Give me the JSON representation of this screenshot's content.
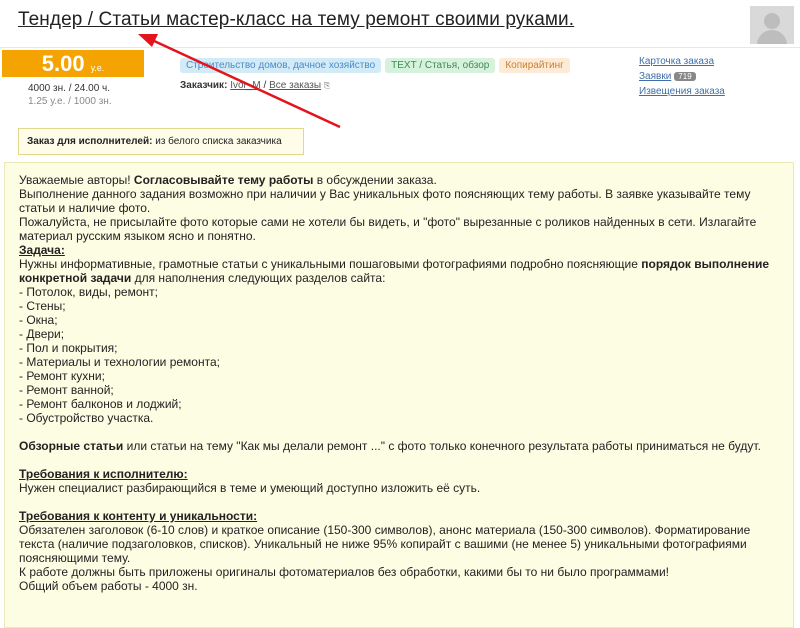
{
  "page": {
    "title": "Тендер / Статьи мастер-класс на тему ремонт своими руками."
  },
  "order": {
    "price": "5.00",
    "currency": "у.е.",
    "volume": "4000 зн. / 24.00 ч.",
    "rate": "1.25 у.е. / 1000 зн.",
    "tags": [
      {
        "label": "Строительство домов, дачное хозяйство",
        "color": "#d3ebf7"
      },
      {
        "label": "TEXT / Статья, обзор",
        "color": "#d6f2dc"
      },
      {
        "label": "Копирайтинг",
        "color": "#fdebd7"
      }
    ],
    "customer_label": "Заказчик:",
    "customer_name": "Ivor_M",
    "customer_sep": "/",
    "all_orders": "Все заказы",
    "links": {
      "card": "Карточка заказа",
      "applications": "Заявки",
      "applications_count": "719",
      "notices": "Извещения заказа"
    },
    "executor_label": "Заказ для исполнителей:",
    "executor_value": "из белого списка заказчика"
  },
  "colors": {
    "price_bg": "#f5a300",
    "arrow": "#e3141b",
    "content_bg": "#fdfde3"
  },
  "content": {
    "intro_1a": "Уважаемые авторы! ",
    "intro_1b": "Согласовывайте тему работы",
    "intro_1c": " в обсуждении заказа.",
    "intro_2": "Выполнение данного задания возможно при наличии у Вас уникальных фото поясняющих тему работы. В заявке указывайте тему статьи и наличие фото.",
    "intro_3": "Пожалуйста, не присылайте фото которые сами не хотели бы видеть, и \"фото\" вырезанные с роликов найденных в сети. Излагайте материал русским языком ясно и понятно.",
    "task_heading": "Задача:",
    "task_a": "Нужны информативные, грамотные статьи с уникальными пошаговыми фотографиями подробно поясняющие ",
    "task_b": "порядок выполнение конкретной задачи",
    "task_c": " для наполнения следующих разделов сайта:",
    "sections": [
      "- Потолок, виды, ремонт;",
      "- Стены;",
      "- Окна;",
      "- Двери;",
      "- Пол и покрытия;",
      "- Материалы и технологии ремонта;",
      "- Ремонт кухни;",
      "- Ремонт ванной;",
      "- Ремонт балконов и лоджий;",
      "- Обустройство участка."
    ],
    "review_a": "Обзорные статьи",
    "review_b": " или статьи на тему \"Как мы делали ремонт ...\" с фото только конечного результата работы приниматься не будут.",
    "req_exec_heading": "Требования к исполнителю:",
    "req_exec_text": "Нужен специалист разбирающийся в теме и умеющий доступно изложить её суть.",
    "req_content_heading": "Требования к контенту и уникальности:",
    "req_content_1": "Обязателен заголовок (6-10 слов) и краткое описание (150-300 символов), анонс материала (150-300 символов). Форматирование текста (наличие подзаголовков, списков). Уникальный не ниже 95% копирайт с вашими (не менее 5) уникальными фотографиями поясняющими тему.",
    "req_content_2": "К работе должны быть приложены оригиналы фотоматериалов без обработки, какими бы то ни было программами!",
    "req_content_3": "Общий объем работы - 4000 зн."
  }
}
